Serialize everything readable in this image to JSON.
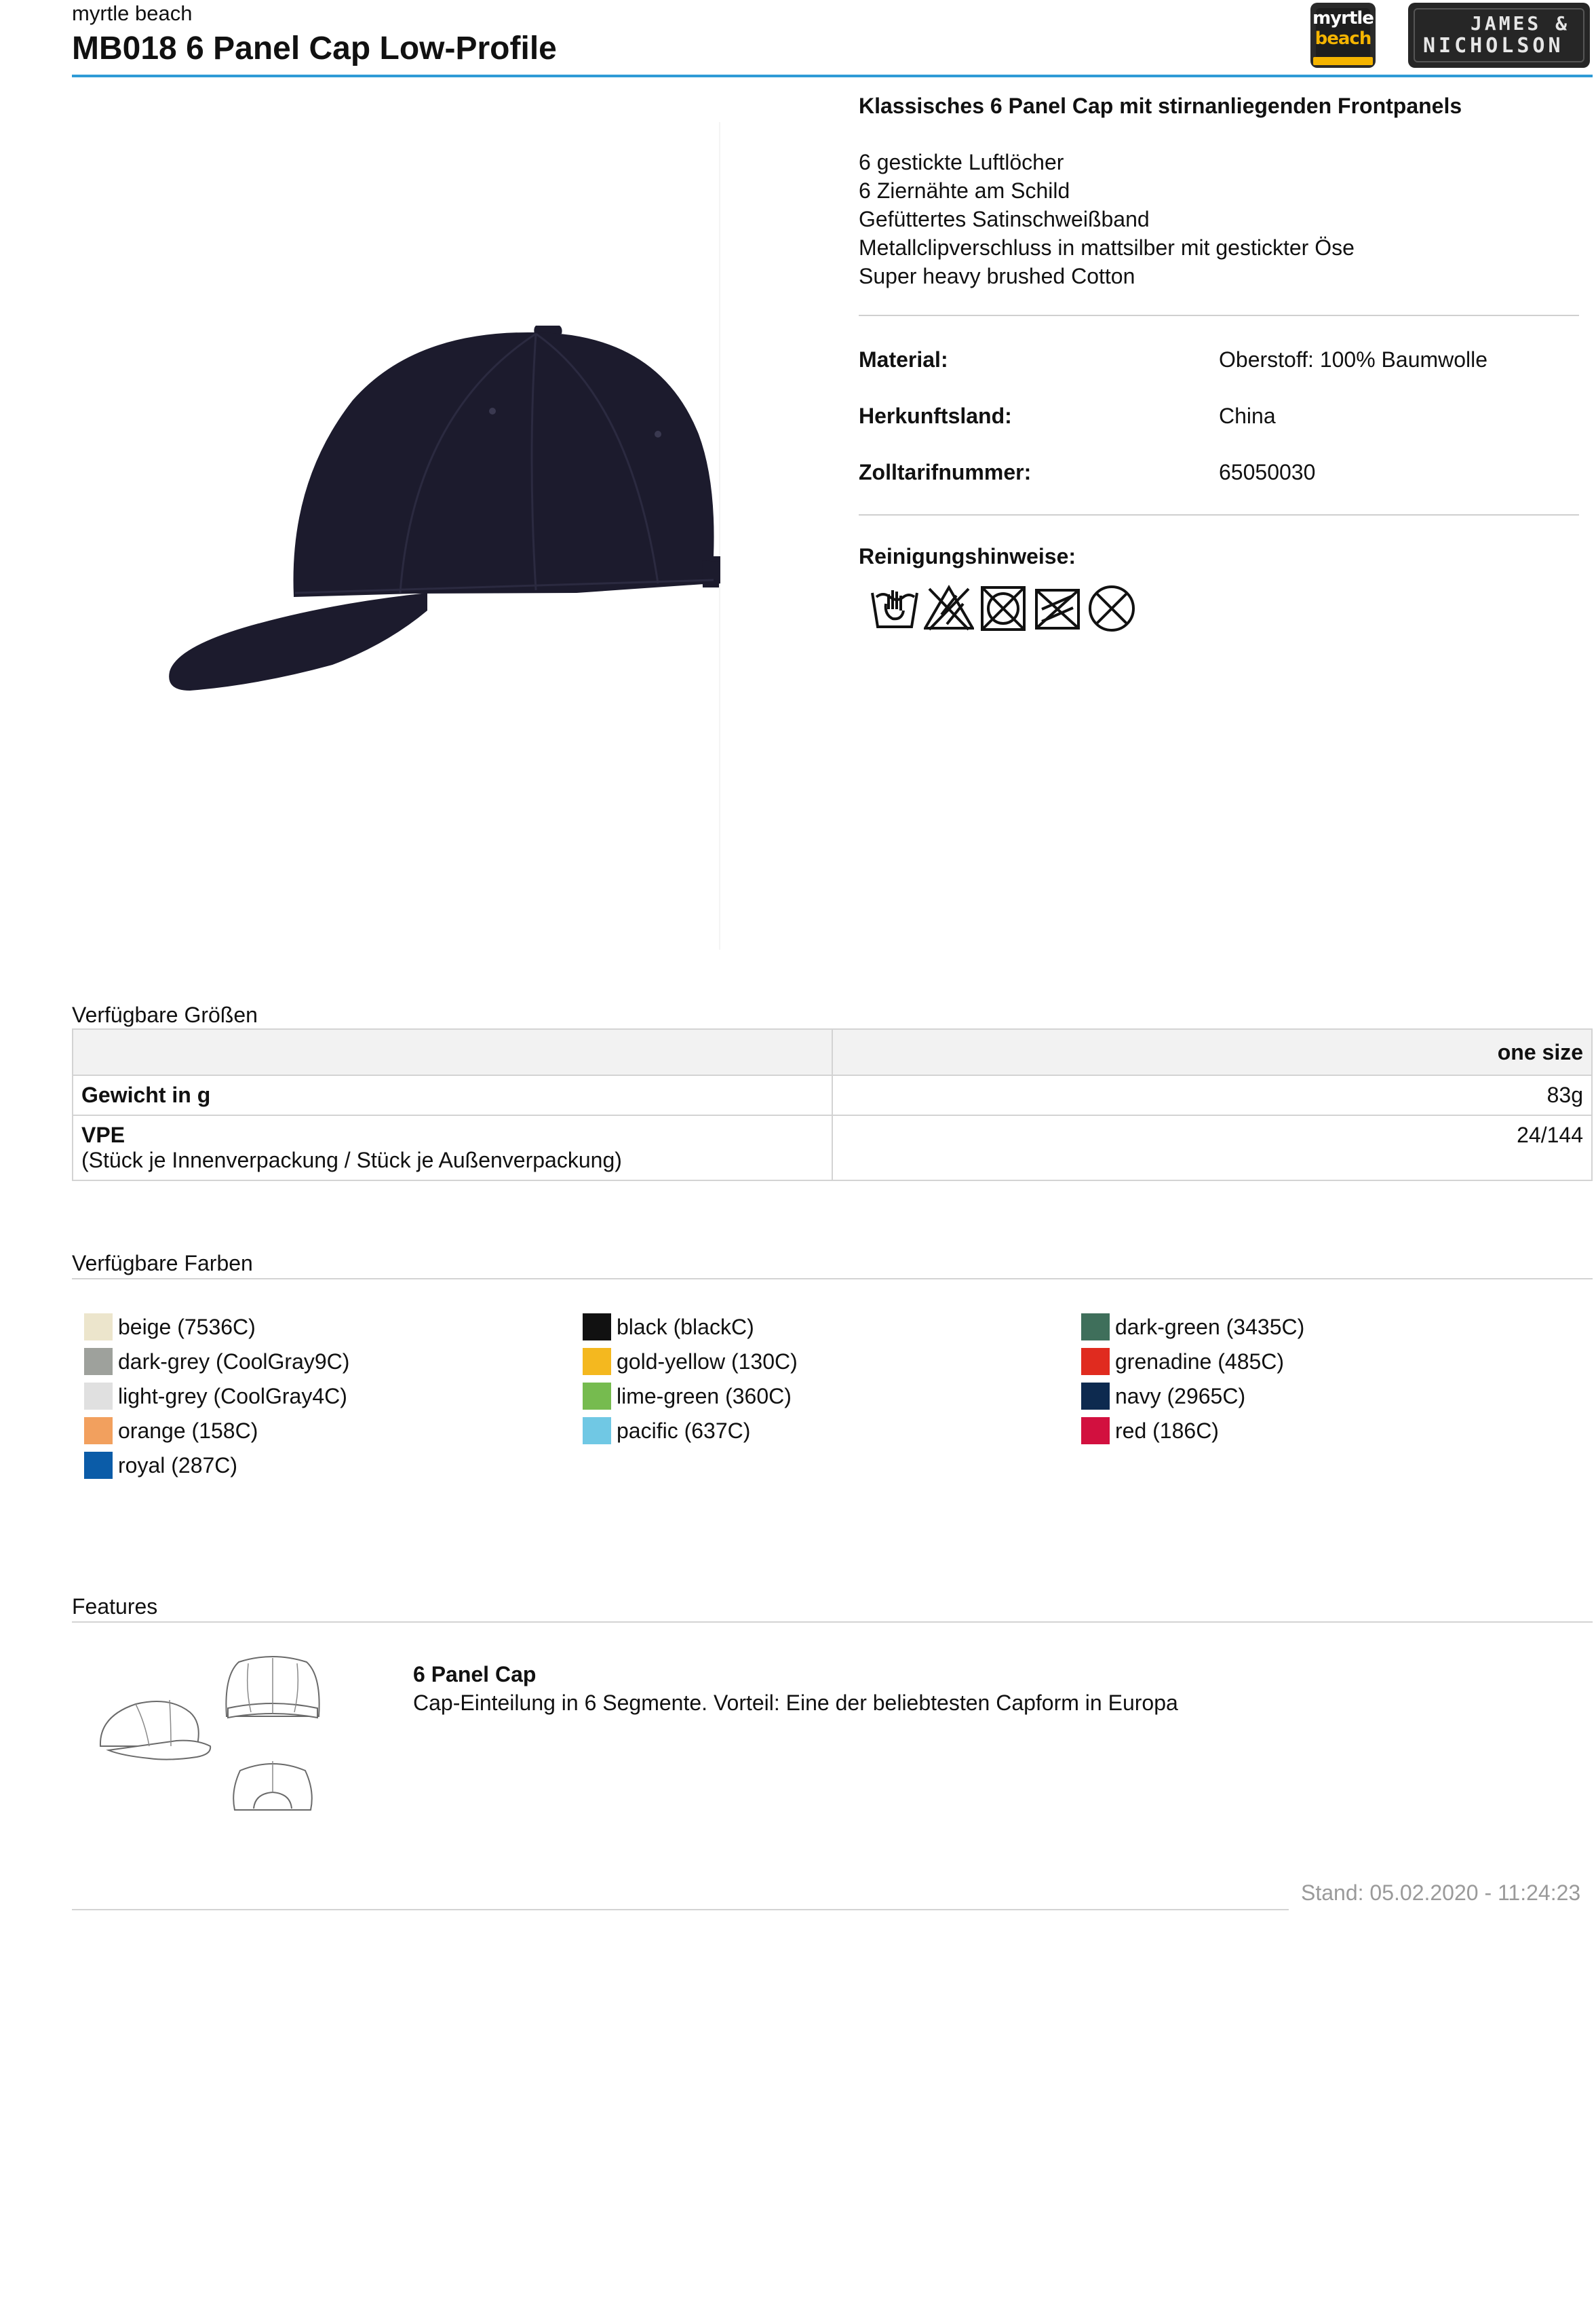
{
  "header": {
    "brand": "myrtle beach",
    "title": "MB018 6 Panel Cap Low-Profile",
    "logo_myrtle": [
      "myrtle",
      "beach"
    ],
    "logo_jn": [
      "JAMES &",
      "NICHOLSON"
    ]
  },
  "description": {
    "headline": "Klassisches 6 Panel Cap mit stirnanliegenden Frontpanels",
    "bullets": [
      "6 gestickte Luftlöcher",
      "6 Ziernähte am Schild",
      "Gefüttertes Satinschweißband",
      "Metallclipverschluss in mattsilber mit gestickter Öse",
      "Super heavy brushed Cotton"
    ]
  },
  "specs": [
    {
      "label": "Material:",
      "value": "Oberstoff: 100% Baumwolle"
    },
    {
      "label": "Herkunftsland:",
      "value": "China"
    },
    {
      "label": "Zolltarifnummer:",
      "value": "65050030"
    }
  ],
  "care": {
    "label": "Reinigungshinweise:",
    "icons": [
      "hand-wash-icon",
      "no-bleach-icon",
      "no-tumble-dry-icon",
      "no-iron-icon",
      "no-dry-clean-icon"
    ]
  },
  "sizes": {
    "title": "Verfügbare Größen",
    "size_header": "one size",
    "rows": [
      {
        "label": "Gewicht in g",
        "sublabel": "",
        "value": "83g"
      },
      {
        "label": "VPE",
        "sublabel": "(Stück je Innenverpackung / Stück je Außenverpackung)",
        "value": "24/144"
      }
    ]
  },
  "colors": {
    "title": "Verfügbare Farben",
    "items": [
      {
        "name": "beige (7536C)",
        "hex": "#ece5cc"
      },
      {
        "name": "black (blackC)",
        "hex": "#111111"
      },
      {
        "name": "dark-green (3435C)",
        "hex": "#3f6f5b"
      },
      {
        "name": "dark-grey (CoolGray9C)",
        "hex": "#9ea19c"
      },
      {
        "name": "gold-yellow (130C)",
        "hex": "#f4b81f"
      },
      {
        "name": "grenadine (485C)",
        "hex": "#e02b1f"
      },
      {
        "name": "light-grey (CoolGray4C)",
        "hex": "#e0e0e0"
      },
      {
        "name": "lime-green (360C)",
        "hex": "#76bb4f"
      },
      {
        "name": "navy (2965C)",
        "hex": "#0d2a4f"
      },
      {
        "name": "orange (158C)",
        "hex": "#f2a05e"
      },
      {
        "name": "pacific (637C)",
        "hex": "#70c8e4"
      },
      {
        "name": "red (186C)",
        "hex": "#d2103f"
      },
      {
        "name": "royal (287C)",
        "hex": "#0b5ca8"
      }
    ]
  },
  "features": {
    "title": "Features",
    "items": [
      {
        "title": "6 Panel Cap",
        "description": "Cap-Einteilung in 6 Segmente. Vorteil: Eine der beliebtesten Capform in Europa"
      }
    ]
  },
  "footer": {
    "stand": "Stand: 05.02.2020 - 11:24:23"
  }
}
